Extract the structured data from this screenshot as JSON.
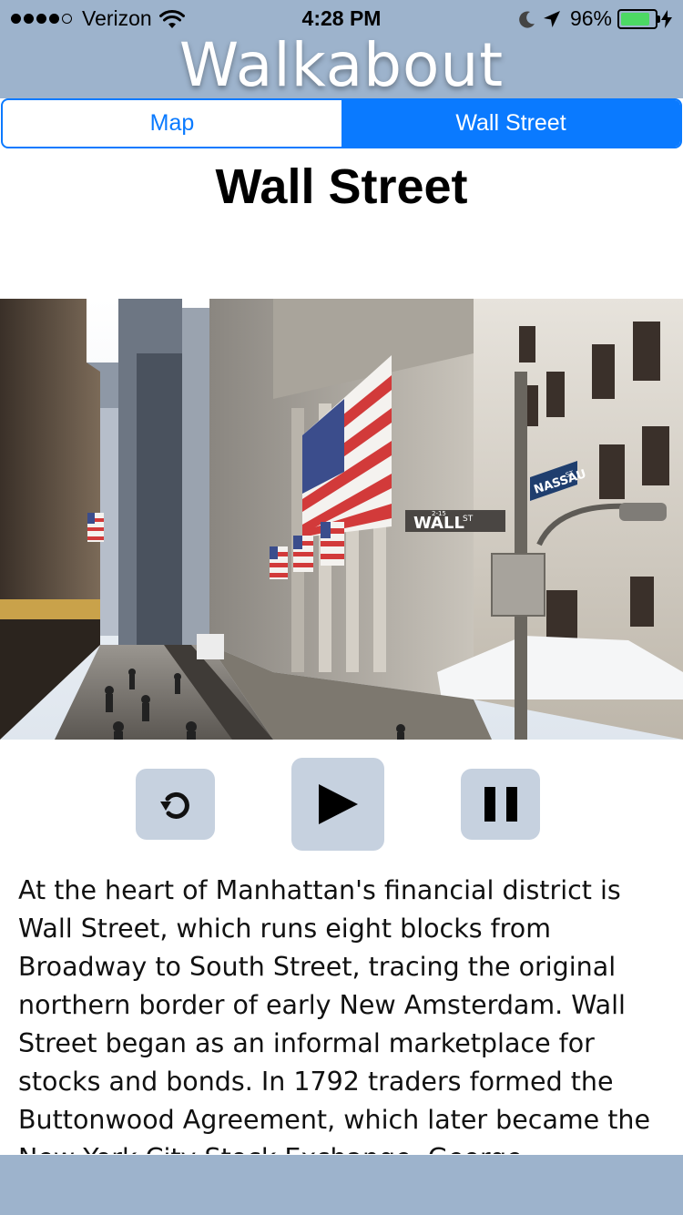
{
  "status_bar": {
    "carrier": "Verizon",
    "time": "4:28 PM",
    "battery_percent": "96%",
    "battery_level": 0.96,
    "signal_bars": 4,
    "icons": [
      "signal-dots-icon",
      "wifi-icon",
      "moon-icon",
      "location-arrow-icon",
      "battery-icon",
      "charging-bolt-icon"
    ]
  },
  "header": {
    "app_title": "Walkabout"
  },
  "tabs": [
    {
      "label": "Map",
      "active": false
    },
    {
      "label": "Wall Street",
      "active": true
    }
  ],
  "place": {
    "title": "Wall Street",
    "photo": {
      "flag_label": "",
      "street_sign": "WALL",
      "street_sign_suffix": "ST",
      "street_sign_number": "2-15",
      "cross_sign": "NASSAU",
      "cross_sign_suffix": "ST"
    },
    "description": "At the heart of Manhattan's financial district is Wall Street, which runs eight blocks from Broadway to South Street, tracing the original northern border of early New Amsterdam. Wall Street began as an informal marketplace for stocks and bonds. In 1792 traders formed the Buttonwood Agreement, which later became the New York City Stock Exchange. George Washington took the first U.S. presidential"
  },
  "audio_controls": {
    "icons": [
      "restart-icon",
      "play-icon",
      "pause-icon"
    ]
  },
  "colors": {
    "header_bg": "#9db3cc",
    "accent": "#0a7aff",
    "control_bg": "#c6d1df",
    "battery_green": "#4cd964"
  }
}
